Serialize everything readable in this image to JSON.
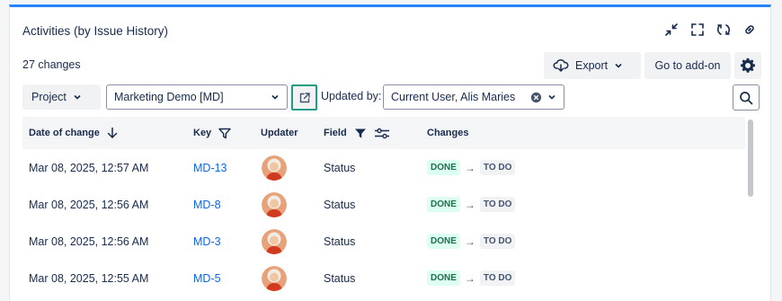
{
  "panel": {
    "title": "Activities (by Issue History)",
    "accent_color": "#2684ff"
  },
  "header_icons": [
    "collapse-icon",
    "expand-icon",
    "refresh-icon",
    "link-icon"
  ],
  "summary": {
    "changes_count": "27 changes"
  },
  "toolbar": {
    "export_label": "Export",
    "addon_label": "Go to add-on"
  },
  "filters": {
    "project_label": "Project",
    "project_value": "Marketing Demo [MD]",
    "updated_by_label": "Updated by:",
    "updated_by_value": "Current User, Alis Maries"
  },
  "table": {
    "headers": {
      "date": "Date of change",
      "key": "Key",
      "updater": "Updater",
      "field": "Field",
      "changes": "Changes"
    },
    "rows": [
      {
        "date": "Mar 08, 2025, 12:57 AM",
        "key": "MD-13",
        "field": "Status",
        "from": "DONE",
        "to": "TO DO"
      },
      {
        "date": "Mar 08, 2025, 12:56 AM",
        "key": "MD-8",
        "field": "Status",
        "from": "DONE",
        "to": "TO DO"
      },
      {
        "date": "Mar 08, 2025, 12:56 AM",
        "key": "MD-3",
        "field": "Status",
        "from": "DONE",
        "to": "TO DO"
      },
      {
        "date": "Mar 08, 2025, 12:55 AM",
        "key": "MD-5",
        "field": "Status",
        "from": "DONE",
        "to": "TO DO"
      }
    ]
  },
  "colors": {
    "link": "#0c66e4",
    "done_bg": "#dcfff1",
    "done_text": "#216e4e",
    "highlight_border": "#1f9e87"
  }
}
